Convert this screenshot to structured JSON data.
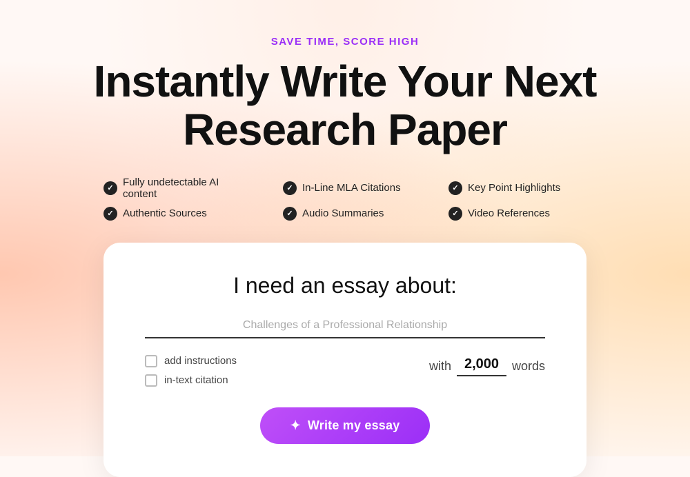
{
  "tagline": "SAVE TIME, SCORE HIGH",
  "headline_line1": "Instantly Write Your Next",
  "headline_line2": "Research Paper",
  "features": [
    {
      "id": "f1",
      "label": "Fully undetectable AI content"
    },
    {
      "id": "f2",
      "label": "In-Line MLA Citations"
    },
    {
      "id": "f3",
      "label": "Key Point Highlights"
    },
    {
      "id": "f4",
      "label": "Authentic Sources"
    },
    {
      "id": "f5",
      "label": "Audio Summaries"
    },
    {
      "id": "f6",
      "label": "Video References"
    }
  ],
  "card": {
    "title": "I need an essay about:",
    "input_placeholder": "Challenges of a Professional Relationship",
    "checkbox1_label": "add instructions",
    "checkbox2_label": "in-text citation",
    "words_prefix": "with",
    "words_value": "2,000",
    "words_suffix": "words",
    "button_label": "Write my essay"
  }
}
